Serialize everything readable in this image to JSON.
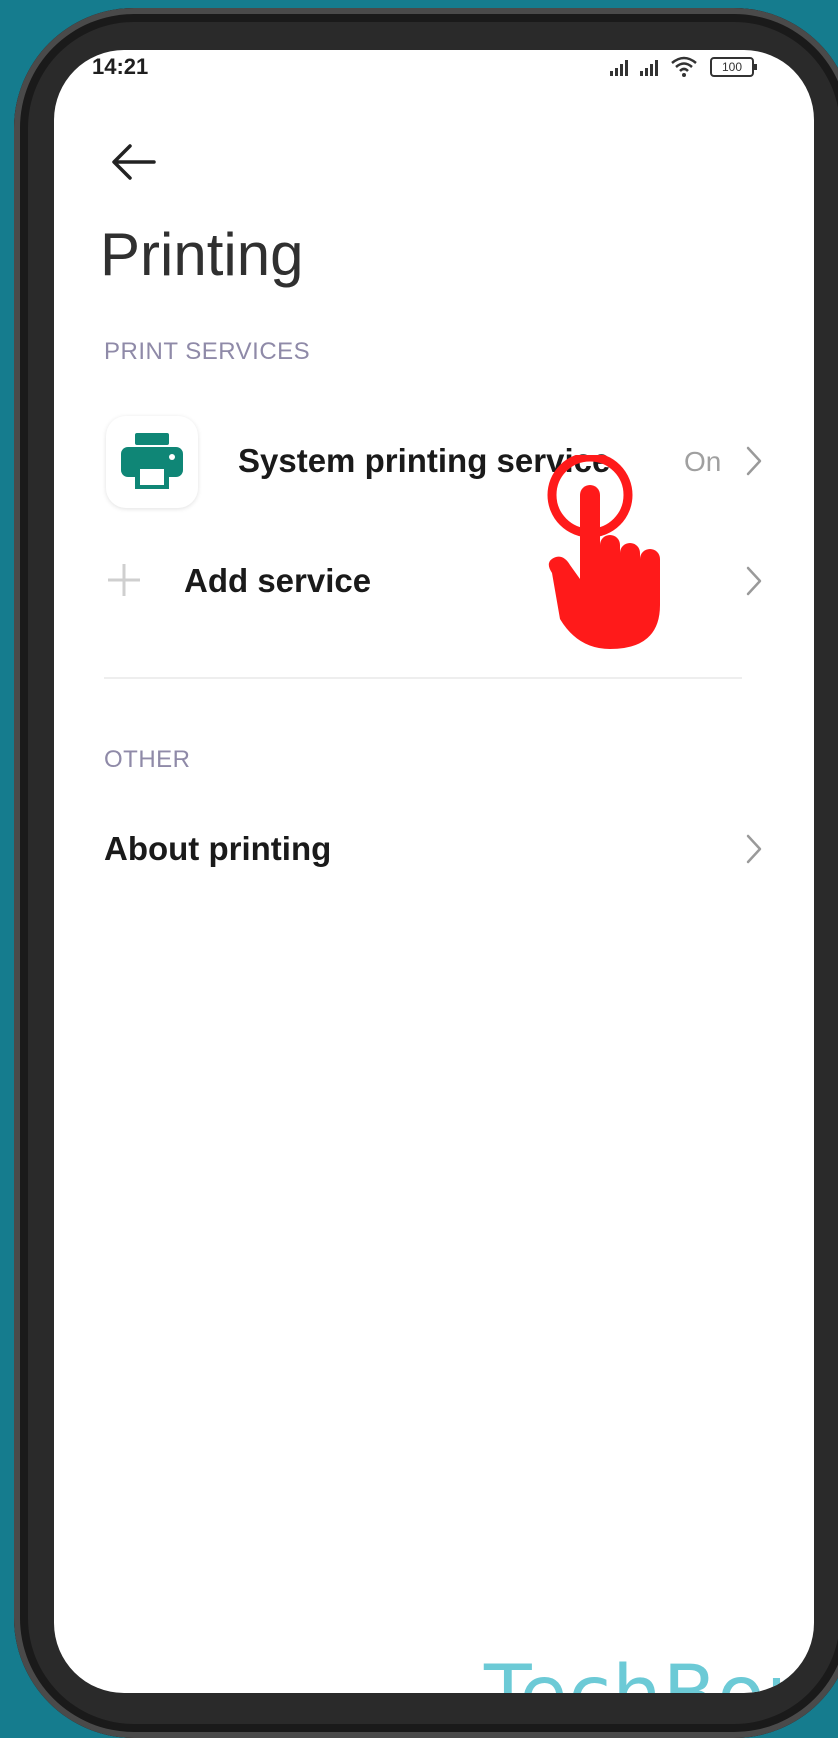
{
  "status_bar": {
    "time": "14:21",
    "battery": "100",
    "icons": [
      "signal-icon",
      "signal-icon",
      "wifi-icon",
      "battery-icon"
    ]
  },
  "header": {
    "back_icon": "arrow-left-icon",
    "title": "Printing"
  },
  "print_services": {
    "header": "PRINT SERVICES",
    "items": [
      {
        "icon": "printer-icon",
        "label": "System printing service",
        "value": "On",
        "chevron": "chevron-right-icon"
      },
      {
        "icon": "plus-icon",
        "label": "Add service",
        "chevron": "chevron-right-icon"
      }
    ]
  },
  "other": {
    "header": "OTHER",
    "items": [
      {
        "label": "About printing",
        "chevron": "chevron-right-icon"
      }
    ]
  },
  "overlay": {
    "tap_icon": "tap-hand-icon",
    "tap_color": "#ff1a1a"
  },
  "watermark": "TechBone",
  "colors": {
    "background": "#157c8e",
    "printer_icon": "#0f8676",
    "section_header": "#8f8aa8",
    "watermark": "#6ccad6"
  }
}
